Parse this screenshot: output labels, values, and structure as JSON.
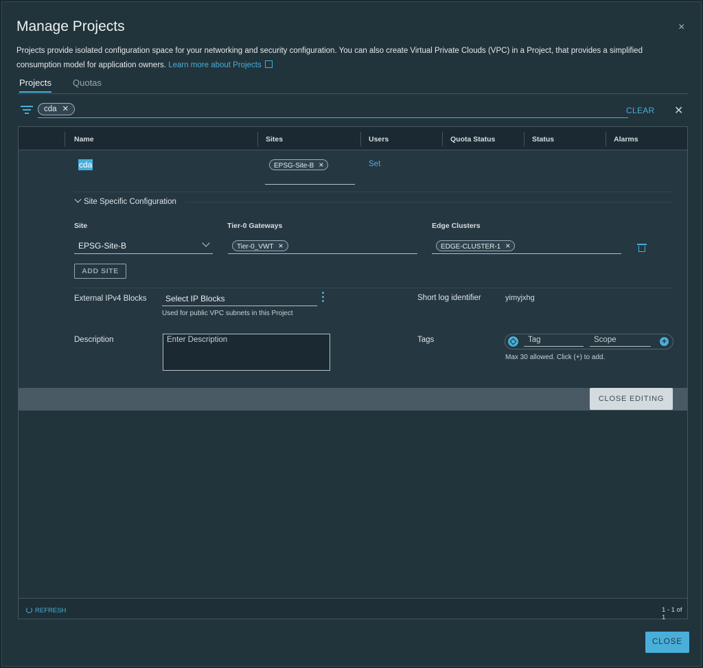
{
  "modal": {
    "title": "Manage Projects",
    "close_glyph": "×",
    "intro_text": "Projects provide isolated configuration space for your networking and security configuration. You can also create Virtual Private Clouds (VPC) in a Project, that provides a simplified consumption model for application owners.",
    "learn_more": "Learn more about Projects"
  },
  "tabs": [
    {
      "label": "Projects",
      "active": true
    },
    {
      "label": "Quotas",
      "active": false
    }
  ],
  "filter": {
    "chip_value": "cda",
    "chip_remove": "✕",
    "clear_label": "CLEAR",
    "close_glyph": "✕"
  },
  "grid": {
    "columns": [
      "Name",
      "Sites",
      "Users",
      "Quota Status",
      "Status",
      "Alarms"
    ],
    "row": {
      "name": "cda",
      "site_chip": "EPSG-Site-B",
      "users_link": "Set"
    },
    "footer": {
      "refresh_label": "REFRESH",
      "pager": "1 - 1 of 1"
    }
  },
  "site_config": {
    "section_label": "Site Specific Configuration",
    "site_label": "Site",
    "tier0_label": "Tier-0 Gateways",
    "edge_label": "Edge Clusters",
    "site_value": "EPSG-Site-B",
    "tier0_chip": "Tier-0_VWT",
    "edge_chip": "EDGE-CLUSTER-1",
    "add_site_label": "ADD SITE"
  },
  "details": {
    "ipv4_label": "External IPv4 Blocks",
    "ipv4_placeholder": "Select IP Blocks",
    "ipv4_helper": "Used for public VPC subnets in this Project",
    "short_log_label": "Short log identifier",
    "short_log_value": "yimyjxhg",
    "description_label": "Description",
    "description_placeholder": "Enter Description",
    "tags_label": "Tags",
    "tag_placeholder": "Tag",
    "scope_placeholder": "Scope",
    "tags_helper": "Max 30 allowed. Click (+) to add."
  },
  "actions": {
    "close_editing": "CLOSE EDITING",
    "close": "CLOSE"
  },
  "colors": {
    "accent": "#49afd9",
    "background": "#21333b",
    "header": "#1b2a32"
  }
}
